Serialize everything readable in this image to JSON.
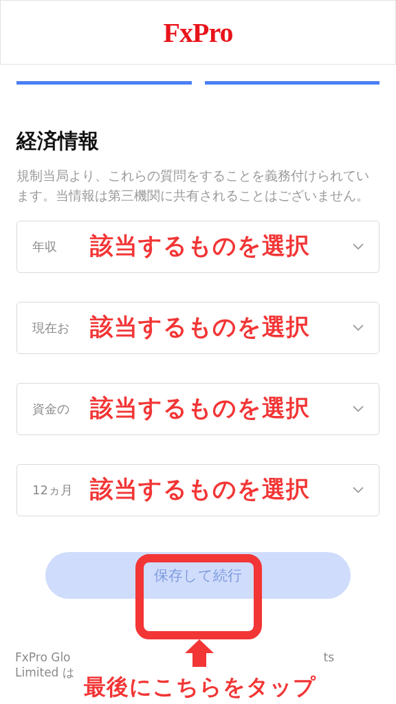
{
  "header": {
    "logo": "FxPro"
  },
  "steps": [
    {
      "complete": true
    },
    {
      "complete": true
    }
  ],
  "section": {
    "title": "経済情報",
    "description": "規制当局より、これらの質問をすることを義務付けられています。当情報は第三機関に共有されることはございません。"
  },
  "selects": [
    {
      "label": "年収",
      "annotation": "該当するものを選択"
    },
    {
      "label": "現在お",
      "annotation": "該当するものを選択"
    },
    {
      "label": "資金の",
      "annotation": "該当するものを選択"
    },
    {
      "label": "12ヵ月",
      "annotation": "該当するものを選択"
    }
  ],
  "button": {
    "label": "保存して続行",
    "disabled": true
  },
  "callout": {
    "text": "最後にこちらをタップ"
  },
  "footer": {
    "line_1_start": "FxPro Glo",
    "line_1_end": "ts",
    "line_2": "Limited は"
  }
}
